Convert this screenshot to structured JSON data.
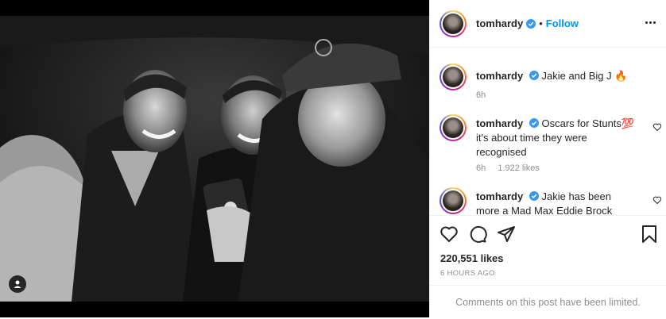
{
  "post": {
    "username": "tomhardy",
    "follow_label": "Follow",
    "separator": "•"
  },
  "comments": [
    {
      "username": "tomhardy",
      "text": "Jakie and Big J 🔥",
      "time": "6h",
      "likes": ""
    },
    {
      "username": "tomhardy",
      "text": "Oscars for Stunts💯 it's about time they were recognised",
      "time": "6h",
      "likes": "1.922 likes"
    },
    {
      "username": "tomhardy",
      "text": "Jakie has been more a Mad Max Eddie Brock Ronnie",
      "time": "",
      "likes": ""
    }
  ],
  "actions": {
    "like_icon": "heart-icon",
    "comment_icon": "comment-icon",
    "share_icon": "share-icon",
    "save_icon": "bookmark-icon"
  },
  "likes_text": "220,551 likes",
  "date_text": "6 HOURS AGO",
  "comments_limited_text": "Comments on this post have been limited.",
  "colors": {
    "accent": "#0095f6",
    "text": "#262626",
    "muted": "#8e8e8e",
    "verified": "#3897f0"
  }
}
